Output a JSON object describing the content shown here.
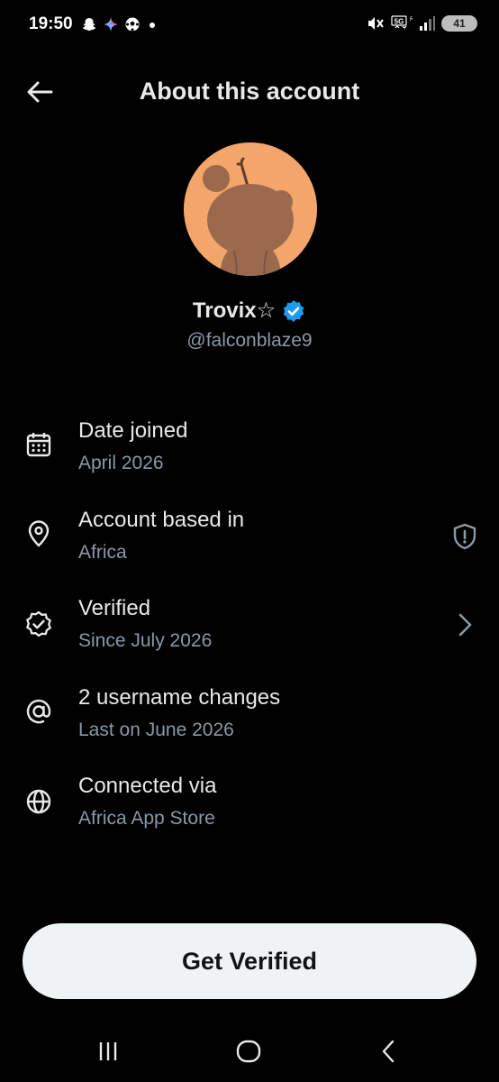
{
  "status_bar": {
    "time": "19:50",
    "left_icons": [
      "snapchat-icon",
      "gemini-icon",
      "soccer-ball-icon",
      "dot-icon"
    ],
    "right_icons": [
      "mute-icon",
      "5g-icon",
      "signal-icon"
    ],
    "battery": "41"
  },
  "header": {
    "title": "About this account"
  },
  "profile": {
    "display_name": "Trovix☆",
    "handle": "@falconblaze9",
    "avatar_color": "#f4a56a",
    "verified_color": "#1d9bf0"
  },
  "info": {
    "date_joined": {
      "title": "Date joined",
      "subtitle": "April 2026",
      "icon": "calendar-icon"
    },
    "account_based": {
      "title": "Account based in",
      "subtitle": "Africa",
      "icon": "location-pin-icon",
      "trailing": "shield-alert-icon"
    },
    "verified": {
      "title": "Verified",
      "subtitle": "Since July 2026",
      "icon": "verified-badge-icon",
      "trailing": "chevron-right-icon"
    },
    "username_changes": {
      "title": "2 username changes",
      "subtitle": "Last on June 2026",
      "icon": "at-icon"
    },
    "connected_via": {
      "title": "Connected via",
      "subtitle": "Africa App Store",
      "icon": "globe-icon"
    }
  },
  "cta": {
    "label": "Get Verified"
  },
  "nav": {
    "icons": [
      "recent-apps-icon",
      "home-icon",
      "back-icon"
    ]
  }
}
